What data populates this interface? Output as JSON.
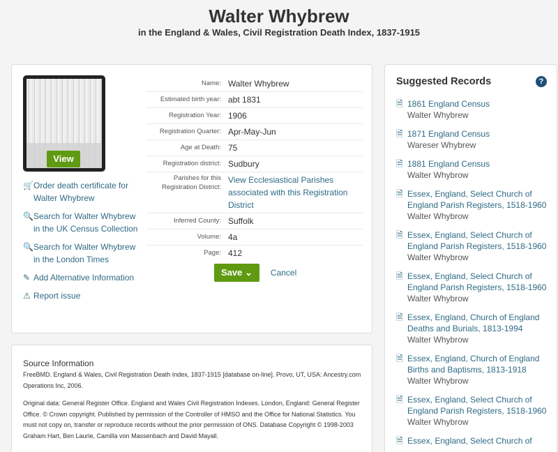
{
  "header": {
    "title": "Walter Whybrew",
    "subtitle": "in the England & Wales, Civil Registration Death Index, 1837-1915"
  },
  "thumbnail": {
    "view_label": "View"
  },
  "actions": [
    {
      "icon": "cart-icon",
      "label": "Order death certificate for Walter Whybrew"
    },
    {
      "icon": "search-icon",
      "label": "Search for Walter Whybrew in the UK Census Collection"
    },
    {
      "icon": "search-icon",
      "label": "Search for Walter Whybrew in the London Times"
    },
    {
      "icon": "pencil-icon",
      "label": "Add Alternative Information"
    },
    {
      "icon": "warning-icon",
      "label": "Report issue"
    }
  ],
  "details": {
    "name": {
      "label": "Name:",
      "value": "Walter Whybrew"
    },
    "birth": {
      "label": "Estimated birth year:",
      "value": "abt 1831"
    },
    "reg_year": {
      "label": "Registration Year:",
      "value": "1906"
    },
    "reg_quarter": {
      "label": "Registration Quarter:",
      "value": "Apr-May-Jun"
    },
    "age": {
      "label": "Age at Death:",
      "value": "75"
    },
    "district": {
      "label": "Registration district:",
      "value": "Sudbury"
    },
    "parishes": {
      "label": "Parishes for this Registration District:",
      "value": "View Ecclesiastical Parishes associated with this Registration District"
    },
    "county": {
      "label": "Inferred County:",
      "value": "Suffolk"
    },
    "volume": {
      "label": "Volume:",
      "value": "4a"
    },
    "page": {
      "label": "Page:",
      "value": "412"
    }
  },
  "buttons": {
    "save": "Save",
    "cancel": "Cancel"
  },
  "source": {
    "title": "Source Information",
    "p1": "FreeBMD. England & Wales, Civil Registration Death Index, 1837-1915 [database on-line]. Provo, UT, USA: Ancestry.com Operations Inc, 2006.",
    "p2": "Original data: General Register Office. England and Wales Civil Registration Indexes. London, England: General Register Office. © Crown copyright. Published by permission of the Controller of HMSO and the Office for National Statistics. You must not copy on, transfer or reproduce records without the prior permission of ONS. Database Copyright © 1998-2003 Graham Hart, Ben Laurie, Camilla von Massenbach and David Mayall."
  },
  "suggested": {
    "title": "Suggested Records",
    "help": "?",
    "items": [
      {
        "title": "1861 England Census",
        "name": "Walter Whybrew"
      },
      {
        "title": "1871 England Census",
        "name": "Wareser Whybrew"
      },
      {
        "title": "1881 England Census",
        "name": "Walter Whybrow"
      },
      {
        "title": "Essex, England, Select Church of England Parish Registers, 1518-1960",
        "name": "Walter Whybrow"
      },
      {
        "title": "Essex, England, Select Church of England Parish Registers, 1518-1960",
        "name": "Walter Whybrow"
      },
      {
        "title": "Essex, England, Select Church of England Parish Registers, 1518-1960",
        "name": "Walter Whybrow"
      },
      {
        "title": "Essex, England, Church of England Deaths and Burials, 1813-1994",
        "name": "Walter Whybrow"
      },
      {
        "title": "Essex, England, Church of England Births and Baptisms, 1813-1918",
        "name": "Walter Whybrow"
      },
      {
        "title": "Essex, England, Select Church of England Parish Registers, 1518-1960",
        "name": "Walter Whybrow"
      },
      {
        "title": "Essex, England, Select Church of",
        "name": ""
      }
    ]
  }
}
